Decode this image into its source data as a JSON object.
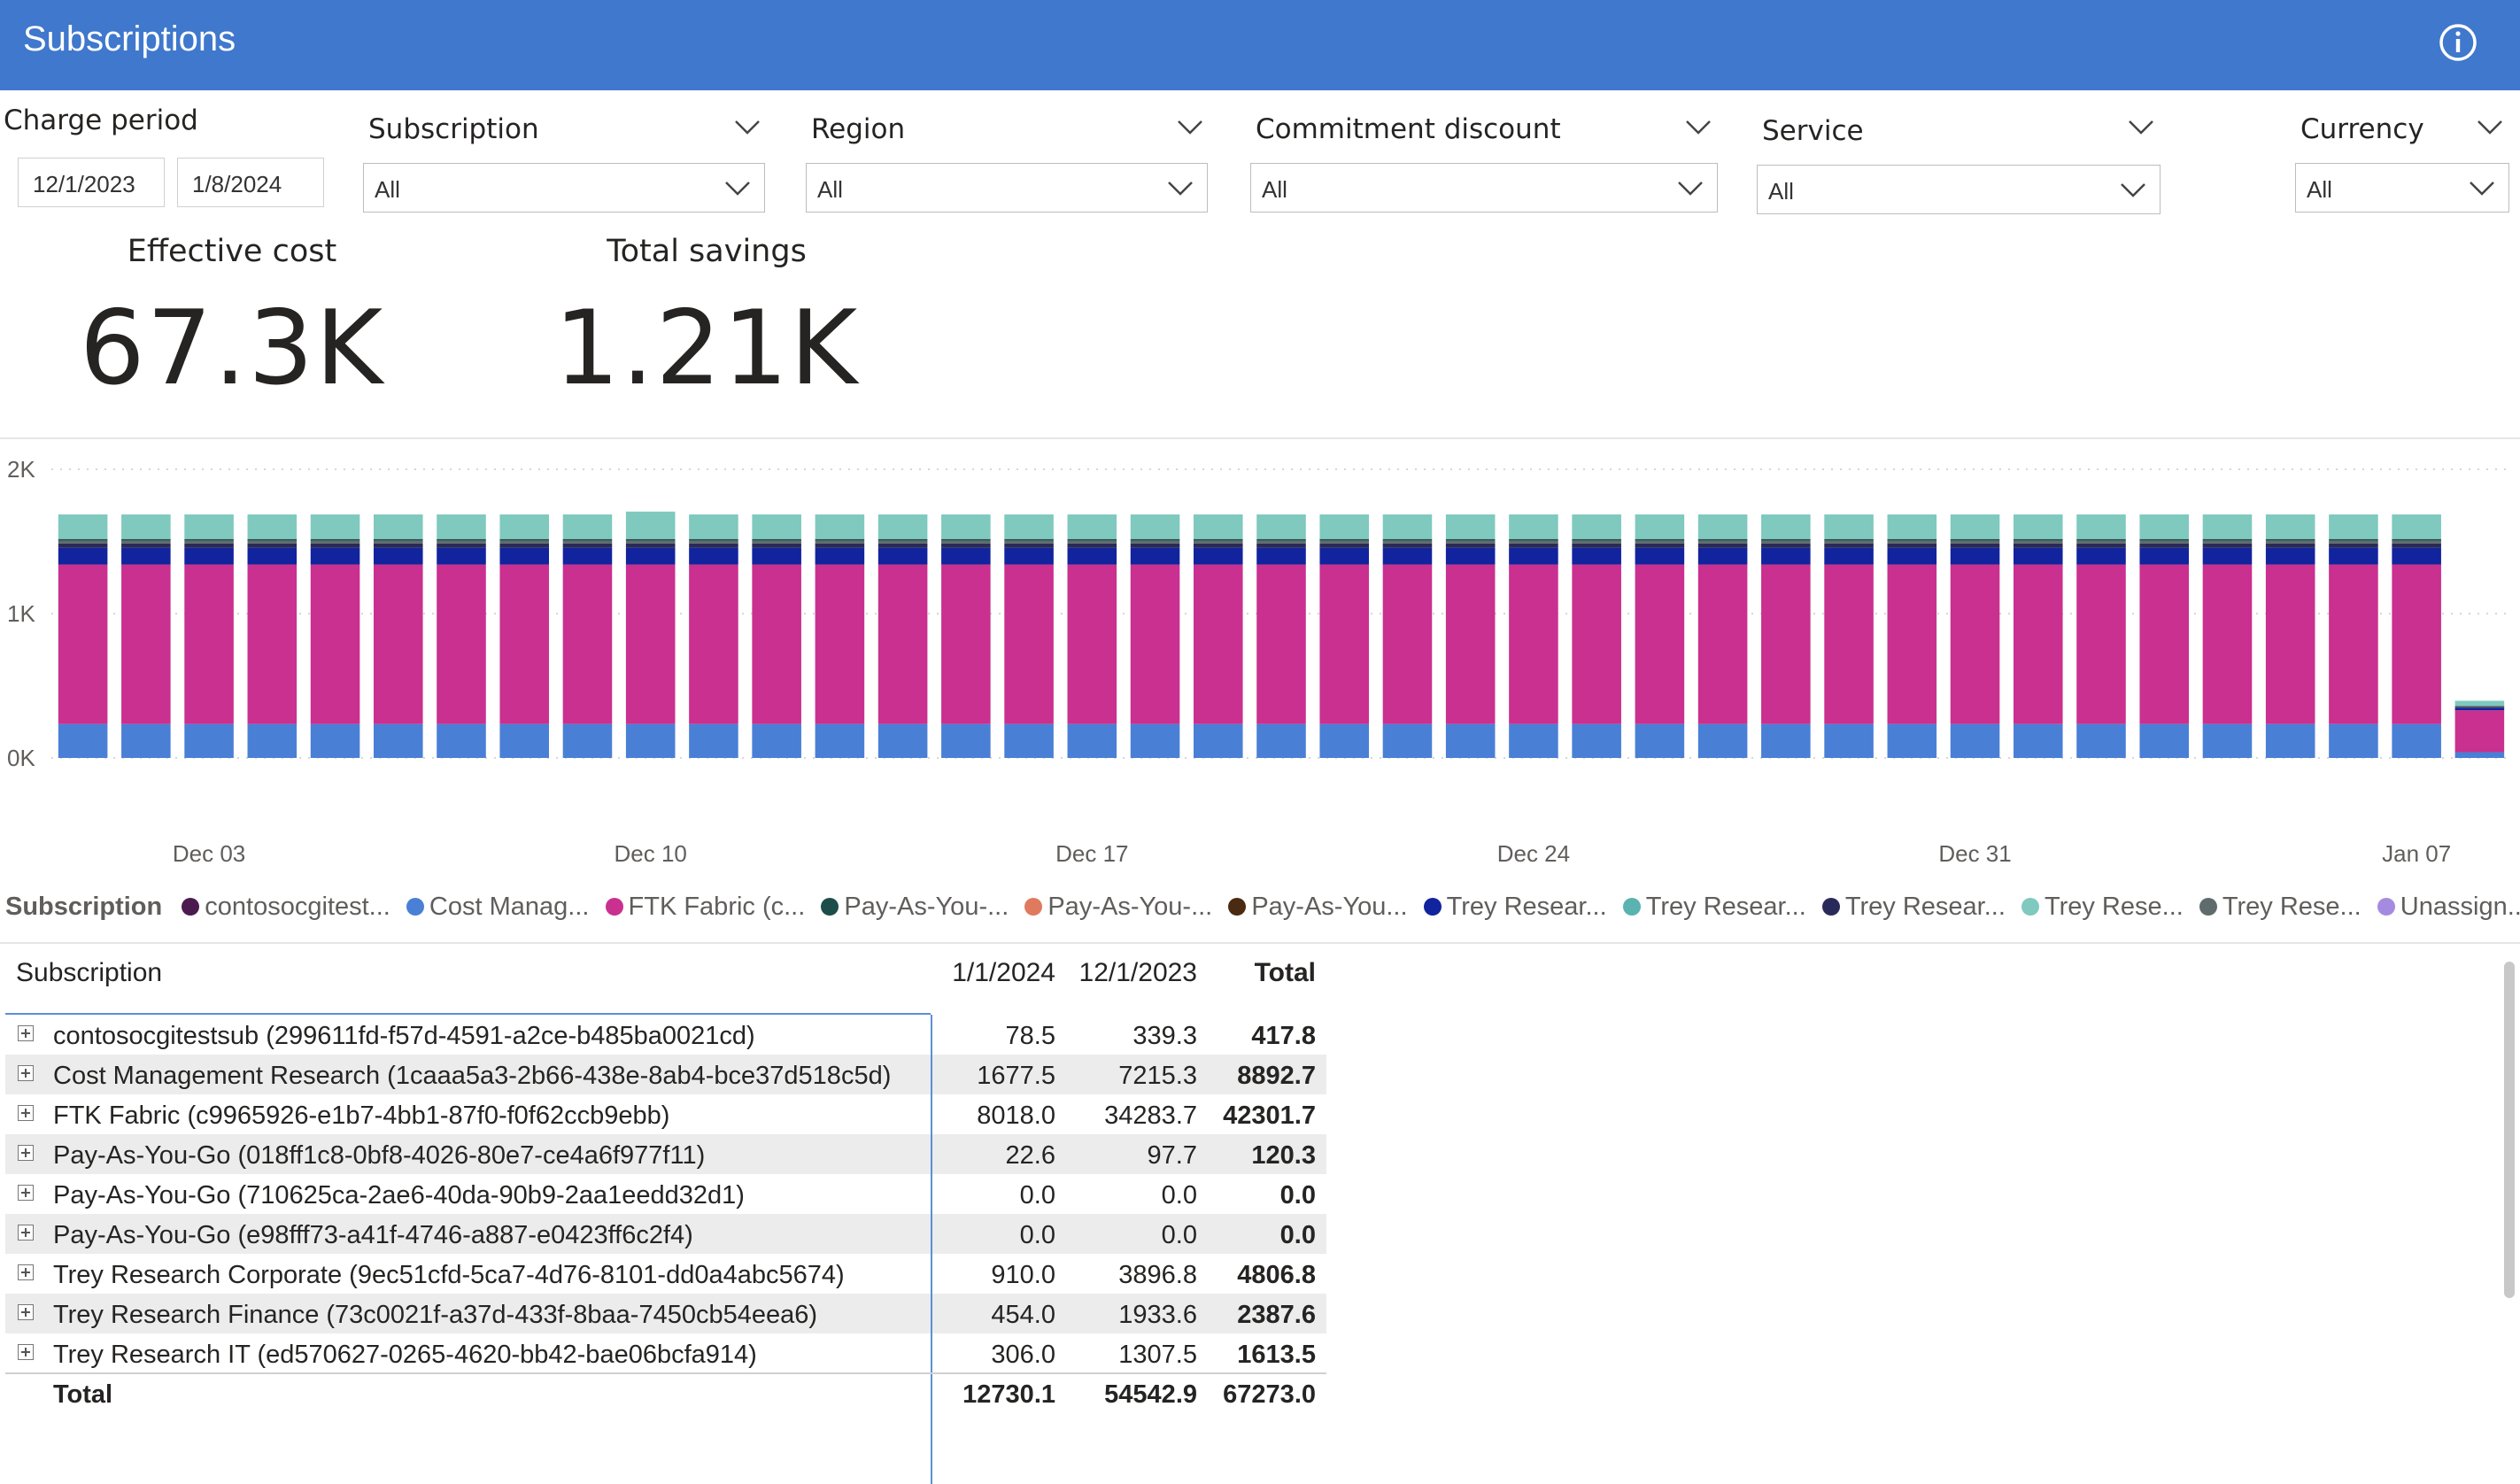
{
  "header": {
    "title": "Subscriptions",
    "info_icon": "info-icon"
  },
  "filters": {
    "charge_period": {
      "label": "Charge period",
      "start": "12/1/2023",
      "end": "1/8/2024"
    },
    "subscription": {
      "label": "Subscription",
      "value": "All"
    },
    "region": {
      "label": "Region",
      "value": "All"
    },
    "commitment_discount": {
      "label": "Commitment discount",
      "value": "All"
    },
    "service": {
      "label": "Service",
      "value": "All"
    },
    "currency": {
      "label": "Currency",
      "value": "All"
    }
  },
  "kpis": {
    "effective_cost": {
      "label": "Effective cost",
      "value": "67.3K"
    },
    "total_savings": {
      "label": "Total savings",
      "value": "1.21K"
    }
  },
  "chart_data": {
    "type": "bar",
    "stacked": true,
    "y_ticks": [
      "0K",
      "1K",
      "2K"
    ],
    "ylim": [
      0,
      2000
    ],
    "x_tick_labels": [
      "Dec 03",
      "Dec 10",
      "Dec 17",
      "Dec 24",
      "Dec 31",
      "Jan 07"
    ],
    "x_tick_category_index": [
      2,
      9,
      16,
      23,
      30,
      37
    ],
    "categories": [
      "Dec 01",
      "Dec 02",
      "Dec 03",
      "Dec 04",
      "Dec 05",
      "Dec 06",
      "Dec 07",
      "Dec 08",
      "Dec 09",
      "Dec 10",
      "Dec 11",
      "Dec 12",
      "Dec 13",
      "Dec 14",
      "Dec 15",
      "Dec 16",
      "Dec 17",
      "Dec 18",
      "Dec 19",
      "Dec 20",
      "Dec 21",
      "Dec 22",
      "Dec 23",
      "Dec 24",
      "Dec 25",
      "Dec 26",
      "Dec 27",
      "Dec 28",
      "Dec 29",
      "Dec 30",
      "Dec 31",
      "Jan 01",
      "Jan 02",
      "Jan 03",
      "Jan 04",
      "Jan 05",
      "Jan 06",
      "Jan 07",
      "Jan 08"
    ],
    "grid": true,
    "legend_position": "bottom",
    "legend_title": "Subscription",
    "series": [
      {
        "name": "Cost Manag...",
        "color": "#4a7fd6",
        "values": [
          235,
          235,
          235,
          235,
          235,
          235,
          235,
          235,
          235,
          235,
          235,
          235,
          235,
          235,
          235,
          235,
          235,
          235,
          235,
          235,
          235,
          235,
          235,
          235,
          235,
          235,
          235,
          235,
          235,
          235,
          235,
          235,
          235,
          235,
          235,
          235,
          235,
          235,
          40
        ]
      },
      {
        "name": "FTK Fabric (c...",
        "color": "#c9308f",
        "values": [
          1105,
          1105,
          1105,
          1105,
          1105,
          1105,
          1105,
          1105,
          1105,
          1105,
          1105,
          1105,
          1105,
          1105,
          1105,
          1105,
          1105,
          1105,
          1105,
          1105,
          1105,
          1105,
          1105,
          1105,
          1105,
          1105,
          1105,
          1105,
          1105,
          1105,
          1105,
          1105,
          1105,
          1105,
          1105,
          1105,
          1105,
          1105,
          290
        ]
      },
      {
        "name": "Trey Resear...",
        "color": "#12239e",
        "values": [
          115,
          115,
          115,
          115,
          115,
          115,
          115,
          115,
          115,
          115,
          115,
          115,
          115,
          115,
          115,
          115,
          115,
          115,
          115,
          115,
          115,
          115,
          115,
          115,
          115,
          115,
          115,
          115,
          115,
          115,
          115,
          115,
          115,
          115,
          115,
          115,
          115,
          115,
          15
        ]
      },
      {
        "name": "Trey Resear...",
        "color": "#2a2a5a",
        "values": [
          30,
          30,
          30,
          30,
          30,
          30,
          30,
          30,
          30,
          30,
          30,
          30,
          30,
          30,
          30,
          30,
          30,
          30,
          30,
          30,
          30,
          30,
          30,
          30,
          30,
          30,
          30,
          30,
          30,
          30,
          30,
          30,
          30,
          30,
          30,
          30,
          30,
          30,
          8
        ]
      },
      {
        "name": "Trey Rese...",
        "color": "#5f6b6d",
        "values": [
          20,
          20,
          20,
          20,
          20,
          20,
          20,
          20,
          20,
          20,
          20,
          20,
          20,
          20,
          20,
          20,
          20,
          20,
          20,
          20,
          20,
          20,
          20,
          20,
          20,
          20,
          20,
          20,
          20,
          20,
          20,
          20,
          20,
          20,
          20,
          20,
          20,
          20,
          5
        ]
      },
      {
        "name": "Pay-As-You-...",
        "color": "#1d4d4a",
        "values": [
          12,
          12,
          12,
          12,
          12,
          12,
          12,
          12,
          12,
          12,
          12,
          12,
          12,
          12,
          12,
          12,
          12,
          12,
          12,
          12,
          12,
          12,
          12,
          12,
          12,
          12,
          12,
          12,
          12,
          12,
          12,
          12,
          12,
          12,
          12,
          12,
          12,
          12,
          3
        ]
      },
      {
        "name": "Trey Rese...",
        "color": "#7fc9bf",
        "values": [
          170,
          170,
          170,
          170,
          170,
          170,
          170,
          170,
          170,
          190,
          170,
          170,
          170,
          170,
          170,
          170,
          170,
          170,
          170,
          170,
          170,
          170,
          170,
          170,
          170,
          170,
          170,
          170,
          170,
          170,
          170,
          170,
          170,
          170,
          170,
          170,
          170,
          170,
          35
        ]
      }
    ]
  },
  "legend": {
    "title": "Subscription",
    "items": [
      {
        "label": "contosocgitest...",
        "color": "#4b1b4f"
      },
      {
        "label": "Cost Manag...",
        "color": "#4a7fd6"
      },
      {
        "label": "FTK Fabric (c...",
        "color": "#c9308f"
      },
      {
        "label": "Pay-As-You-...",
        "color": "#1d4d4a"
      },
      {
        "label": "Pay-As-You-...",
        "color": "#e07a5f"
      },
      {
        "label": "Pay-As-You...",
        "color": "#4a2a10"
      },
      {
        "label": "Trey Resear...",
        "color": "#12239e"
      },
      {
        "label": "Trey Resear...",
        "color": "#5ab3b0"
      },
      {
        "label": "Trey Resear...",
        "color": "#2a2a5a"
      },
      {
        "label": "Trey Rese...",
        "color": "#7fc9bf"
      },
      {
        "label": "Trey Rese...",
        "color": "#5f6b6d"
      },
      {
        "label": "Unassign...",
        "color": "#a58be0"
      }
    ]
  },
  "table": {
    "headers": {
      "subscription": "Subscription",
      "col1": "1/1/2024",
      "col2": "12/1/2023",
      "total": "Total"
    },
    "rows": [
      {
        "name": "contosocgitestsub (299611fd-f57d-4591-a2ce-b485ba0021cd)",
        "col1": "78.5",
        "col2": "339.3",
        "total": "417.8"
      },
      {
        "name": "Cost Management Research (1caaa5a3-2b66-438e-8ab4-bce37d518c5d)",
        "col1": "1677.5",
        "col2": "7215.3",
        "total": "8892.7"
      },
      {
        "name": "FTK Fabric (c9965926-e1b7-4bb1-87f0-f0f62ccb9ebb)",
        "col1": "8018.0",
        "col2": "34283.7",
        "total": "42301.7"
      },
      {
        "name": "Pay-As-You-Go (018ff1c8-0bf8-4026-80e7-ce4a6f977f11)",
        "col1": "22.6",
        "col2": "97.7",
        "total": "120.3"
      },
      {
        "name": "Pay-As-You-Go (710625ca-2ae6-40da-90b9-2aa1eedd32d1)",
        "col1": "0.0",
        "col2": "0.0",
        "total": "0.0"
      },
      {
        "name": "Pay-As-You-Go (e98fff73-a41f-4746-a887-e0423ff6c2f4)",
        "col1": "0.0",
        "col2": "0.0",
        "total": "0.0"
      },
      {
        "name": "Trey Research Corporate (9ec51cfd-5ca7-4d76-8101-dd0a4abc5674)",
        "col1": "910.0",
        "col2": "3896.8",
        "total": "4806.8"
      },
      {
        "name": "Trey Research Finance (73c0021f-a37d-433f-8baa-7450cb54eea6)",
        "col1": "454.0",
        "col2": "1933.6",
        "total": "2387.6"
      },
      {
        "name": "Trey Research IT (ed570627-0265-4620-bb42-bae06bcfa914)",
        "col1": "306.0",
        "col2": "1307.5",
        "total": "1613.5"
      }
    ],
    "total_row": {
      "name": "Total",
      "col1": "12730.1",
      "col2": "54542.9",
      "total": "67273.0"
    }
  }
}
